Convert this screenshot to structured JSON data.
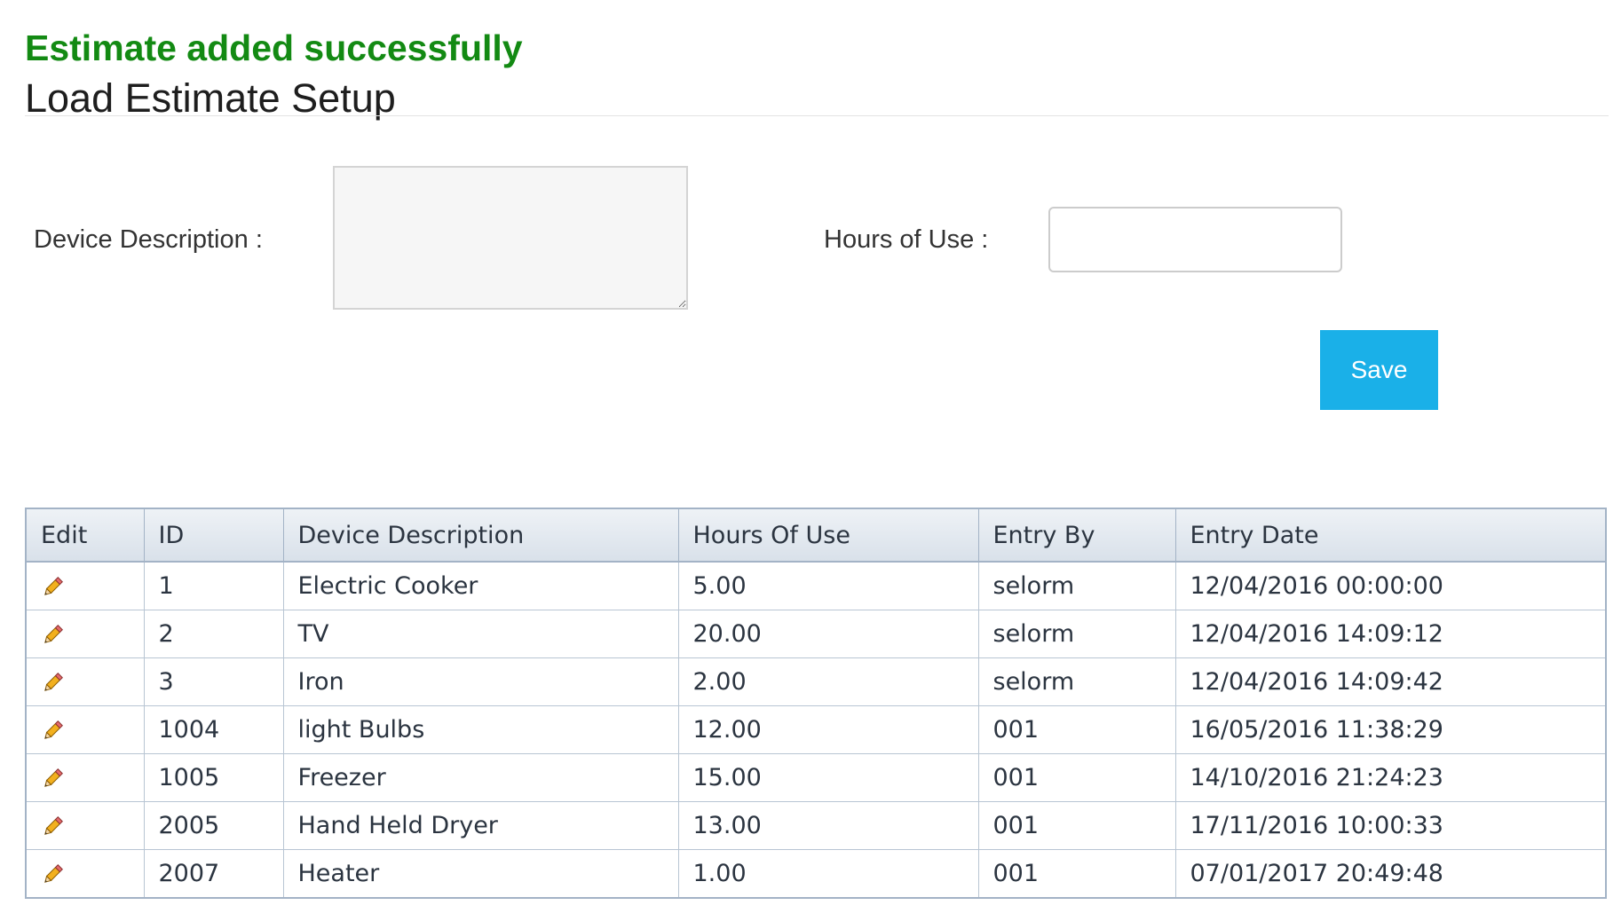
{
  "message": {
    "success": "Estimate added successfully"
  },
  "page": {
    "title": "Load Estimate Setup"
  },
  "form": {
    "device_description_label": "Device Description :",
    "device_description_value": "",
    "hours_of_use_label": "Hours of Use :",
    "hours_of_use_value": "",
    "save_label": "Save"
  },
  "table": {
    "columns": [
      "Edit",
      "ID",
      "Device Description",
      "Hours Of Use",
      "Entry By",
      "Entry Date"
    ],
    "edit_icon": "pencil-icon",
    "rows": [
      {
        "id": "1",
        "description": "Electric Cooker",
        "hours": "5.00",
        "entry_by": "selorm",
        "entry_date": "12/04/2016 00:00:00"
      },
      {
        "id": "2",
        "description": "TV",
        "hours": "20.00",
        "entry_by": "selorm",
        "entry_date": "12/04/2016 14:09:12"
      },
      {
        "id": "3",
        "description": "Iron",
        "hours": "2.00",
        "entry_by": "selorm",
        "entry_date": "12/04/2016 14:09:42"
      },
      {
        "id": "1004",
        "description": "light Bulbs",
        "hours": "12.00",
        "entry_by": "001",
        "entry_date": "16/05/2016 11:38:29"
      },
      {
        "id": "1005",
        "description": "Freezer",
        "hours": "15.00",
        "entry_by": "001",
        "entry_date": "14/10/2016 21:24:23"
      },
      {
        "id": "2005",
        "description": "Hand Held Dryer",
        "hours": "13.00",
        "entry_by": "001",
        "entry_date": "17/11/2016 10:00:33"
      },
      {
        "id": "2007",
        "description": "Heater",
        "hours": "1.00",
        "entry_by": "001",
        "entry_date": "07/01/2017 20:49:48"
      }
    ]
  },
  "colors": {
    "success": "#138a13",
    "button": "#1ab0e8",
    "grid_border": "#a3b3c6",
    "header_bg": "#d9e1ea"
  }
}
